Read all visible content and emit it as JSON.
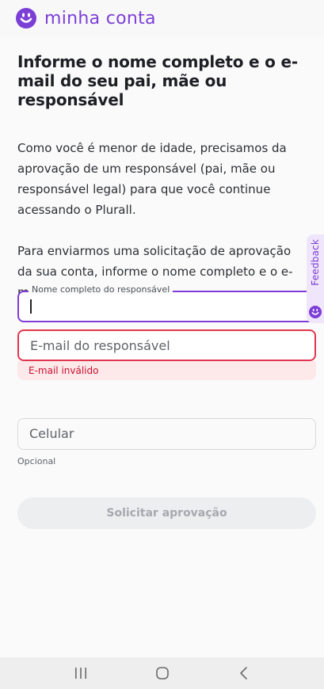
{
  "header": {
    "brand": "minha conta",
    "logo_icon": "smiley-logo-icon",
    "accent_color": "#7c3fd6"
  },
  "main": {
    "title": "Informe o nome completo e o e-mail do seu pai, mãe ou responsável",
    "paragraph1": "Como você é menor de idade, precisamos da aprovação de um responsável (pai, mãe ou responsável legal) para que você continue acessando o Plurall.",
    "paragraph2": "Para enviarmos uma solicitação de aprovação da sua conta, informe o nome completo e o e-mail do seu responsável."
  },
  "form": {
    "name_field": {
      "label": "Nome completo do responsável",
      "value": ""
    },
    "email_field": {
      "placeholder": "E-mail do responsável",
      "value": "",
      "error": "E-mail inválido"
    },
    "phone_field": {
      "placeholder": "Celular",
      "value": "",
      "helper": "Opcional"
    },
    "submit_label": "Solicitar aprovação"
  },
  "feedback_tab": {
    "label": "Feedback",
    "icon": "smiley-icon"
  },
  "navbar": {
    "recents_icon": "recent-apps-icon",
    "home_icon": "home-icon",
    "back_icon": "back-icon"
  },
  "colors": {
    "primary": "#7f3cd6",
    "error": "#e1364f",
    "error_bg": "#fde8ea",
    "disabled_text": "#a6a9ad"
  }
}
